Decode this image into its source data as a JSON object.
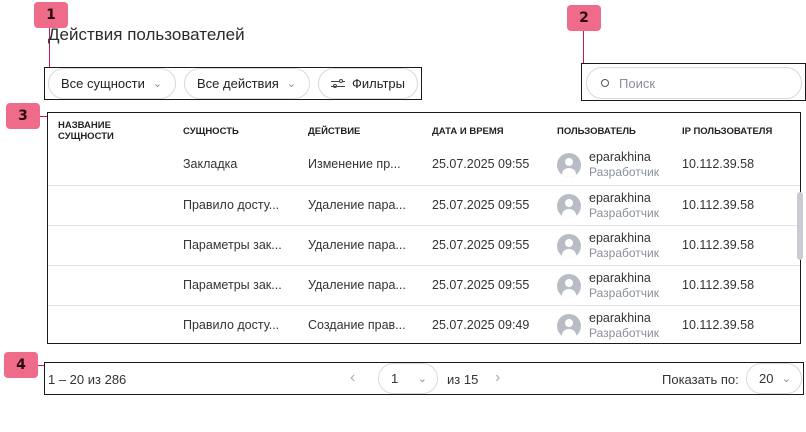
{
  "markers": [
    "1",
    "2",
    "3",
    "4"
  ],
  "page_title": "Действия пользователей",
  "filters": {
    "entities_label": "Все сущности",
    "actions_label": "Все действия",
    "filters_label": "Фильтры"
  },
  "search": {
    "placeholder": "Поиск",
    "value": ""
  },
  "table": {
    "headers": [
      "НАЗВАНИЕ СУЩНОСТИ",
      "СУЩНОСТЬ",
      "ДЕЙСТВИЕ",
      "ДАТА И ВРЕМЯ",
      "ПОЛЬЗОВАТЕЛЬ",
      "IP ПОЛЬЗОВАТЕЛЯ"
    ],
    "header_name_line1": "НАЗВАНИЕ",
    "header_name_line2": "СУЩНОСТИ",
    "rows": [
      {
        "name": "",
        "entity": "Закладка",
        "action": "Изменение пр...",
        "datetime": "25.07.2025 09:55",
        "user": "eparakhina",
        "role": "Разработчик",
        "ip": "10.112.39.58"
      },
      {
        "name": "",
        "entity": "Правило досту...",
        "action": "Удаление пара...",
        "datetime": "25.07.2025 09:55",
        "user": "eparakhina",
        "role": "Разработчик",
        "ip": "10.112.39.58"
      },
      {
        "name": "",
        "entity": "Параметры зак...",
        "action": "Удаление пара...",
        "datetime": "25.07.2025 09:55",
        "user": "eparakhina",
        "role": "Разработчик",
        "ip": "10.112.39.58"
      },
      {
        "name": "",
        "entity": "Параметры зак...",
        "action": "Удаление пара...",
        "datetime": "25.07.2025 09:55",
        "user": "eparakhina",
        "role": "Разработчик",
        "ip": "10.112.39.58"
      },
      {
        "name": "",
        "entity": "Правило досту...",
        "action": "Создание прав...",
        "datetime": "25.07.2025 09:49",
        "user": "eparakhina",
        "role": "Разработчик",
        "ip": "10.112.39.58"
      }
    ]
  },
  "pagination": {
    "range": "1 – 20 из 286",
    "current_page": "1",
    "of_pages": "из 15",
    "page_size_label": "Показать по:",
    "page_size": "20"
  },
  "colors": {
    "marker": "#ef6b8a",
    "callout": "#c2185b",
    "muted": "#8a8f98"
  }
}
